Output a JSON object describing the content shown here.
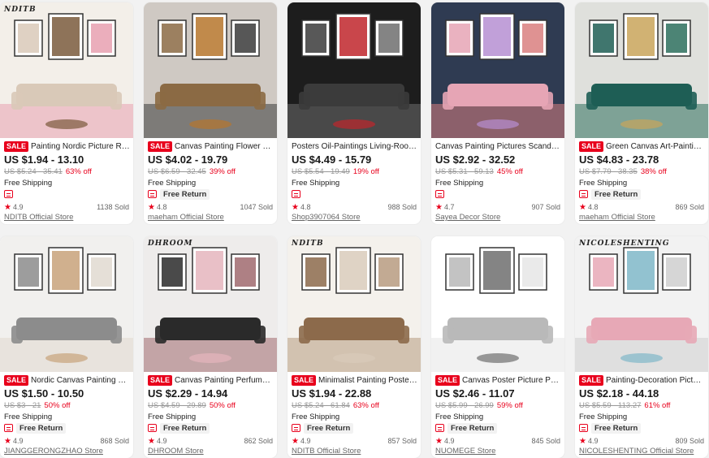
{
  "products": [
    {
      "sale_badge": "SALE",
      "title": "Painting Nordic Picture Ro...",
      "price": "US $1.94 - 13.10",
      "original_price": "US $5.24 - 35.41",
      "discount": "63% off",
      "shipping": "Free Shipping",
      "return_label": "",
      "rating": "4.9",
      "sold": "1138 Sold",
      "store": "NDITB Official Store",
      "image": {
        "overlay_text": "NDITB",
        "palette": [
          "#f3efe9",
          "#d9c9b8",
          "#7a5a3c",
          "#e8a0b0"
        ]
      }
    },
    {
      "sale_badge": "SALE",
      "title": "Canvas Painting Flower W...",
      "price": "US $4.02 - 19.79",
      "original_price": "US $6.59 - 32.45",
      "discount": "39% off",
      "shipping": "Free Shipping",
      "return_label": "Free Return",
      "rating": "4.8",
      "sold": "1047 Sold",
      "store": "maeham Official Store",
      "image": {
        "overlay_text": "",
        "palette": [
          "#cfc9c3",
          "#8b6a44",
          "#b6762c",
          "#3a3a3a"
        ]
      }
    },
    {
      "sale_badge": "",
      "title": "Posters Oil-Paintings Living-Room-...",
      "price": "US $4.49 - 15.79",
      "original_price": "US $5.54 - 19.49",
      "discount": "19% off",
      "shipping": "Free Shipping",
      "return_label": "",
      "rating": "4.8",
      "sold": "988 Sold",
      "store": "Shop3907064 Store",
      "image": {
        "overlay_text": "",
        "palette": [
          "#1d1d1d",
          "#3b3b3b",
          "#c0262c",
          "#6e6e6e"
        ]
      }
    },
    {
      "sale_badge": "",
      "title": "Canvas Painting Pictures Scandina...",
      "price": "US $2.92 - 32.52",
      "original_price": "US $5.31 - 59.13",
      "discount": "45% off",
      "shipping": "Free Shipping",
      "return_label": "",
      "rating": "4.7",
      "sold": "907 Sold",
      "store": "Sayea Decor Store",
      "image": {
        "overlay_text": "",
        "palette": [
          "#2f3b52",
          "#e6a5b5",
          "#b68fd2",
          "#d97f7f"
        ]
      }
    },
    {
      "sale_badge": "SALE",
      "title": "Green Canvas Art-Painting...",
      "price": "US $4.83 - 23.78",
      "original_price": "US $7.79 - 38.35",
      "discount": "38% off",
      "shipping": "Free Shipping",
      "return_label": "Free Return",
      "rating": "4.8",
      "sold": "869 Sold",
      "store": "maeham Official Store",
      "image": {
        "overlay_text": "",
        "palette": [
          "#dfe0dc",
          "#1e5e55",
          "#c9a55a",
          "#2d6f5d"
        ]
      }
    },
    {
      "sale_badge": "SALE",
      "title": "Nordic Canvas Painting Fi...",
      "price": "US $1.50 - 10.50",
      "original_price": "US $3 - 21",
      "discount": "50% off",
      "shipping": "Free Shipping",
      "return_label": "Free Return",
      "rating": "4.9",
      "sold": "868 Sold",
      "store": "JIANGGERONGZHAO Store",
      "image": {
        "overlay_text": "",
        "palette": [
          "#f1f0ee",
          "#8c8c8c",
          "#c8a27a",
          "#e0d9d0"
        ]
      }
    },
    {
      "sale_badge": "SALE",
      "title": "Canvas Painting Perfume ...",
      "price": "US $2.29 - 14.94",
      "original_price": "US $4.59 - 29.89",
      "discount": "50% off",
      "shipping": "Free Shipping",
      "return_label": "Free Return",
      "rating": "4.9",
      "sold": "862 Sold",
      "store": "DHROOM Store",
      "image": {
        "overlay_text": "DHROOM",
        "palette": [
          "#eeeceb",
          "#2a2a2a",
          "#e5b5bd",
          "#a06a6e"
        ]
      }
    },
    {
      "sale_badge": "SALE",
      "title": "Minimalist Painting Poster...",
      "price": "US $1.94 - 22.88",
      "original_price": "US $5.24 - 61.84",
      "discount": "63% off",
      "shipping": "Free Shipping",
      "return_label": "Free Return",
      "rating": "4.9",
      "sold": "857 Sold",
      "store": "NDITB Official Store",
      "image": {
        "overlay_text": "NDITB",
        "palette": [
          "#f4f1ec",
          "#8c6a4b",
          "#d9cbbb",
          "#b79b80"
        ]
      }
    },
    {
      "sale_badge": "SALE",
      "title": "Canvas Poster Picture Pai...",
      "price": "US $2.46 - 11.07",
      "original_price": "US $5.99 - 26.99",
      "discount": "59% off",
      "shipping": "Free Shipping",
      "return_label": "Free Return",
      "rating": "4.9",
      "sold": "845 Sold",
      "store": "NUOMEGE Store",
      "image": {
        "overlay_text": "",
        "palette": [
          "#ffffff",
          "#b9b9b9",
          "#6f6f6f",
          "#e6e6e6"
        ]
      }
    },
    {
      "sale_badge": "SALE",
      "title": "Painting-Decoration Pictur...",
      "price": "US $2.18 - 44.18",
      "original_price": "US $5.59 - 113.27",
      "discount": "61% off",
      "shipping": "Free Shipping",
      "return_label": "Free Return",
      "rating": "4.9",
      "sold": "809 Sold",
      "store": "NICOLESHENTING Official Store",
      "image": {
        "overlay_text": "NICOLESHENTING",
        "palette": [
          "#f2f2f2",
          "#e7a8b6",
          "#7fb7c8",
          "#cfcfcf"
        ]
      }
    }
  ]
}
